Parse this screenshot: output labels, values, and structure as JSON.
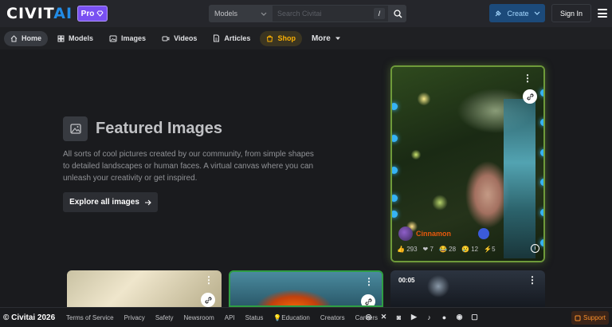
{
  "header": {
    "logo_main": "CIVIT",
    "logo_accent": "AI",
    "pro_label": "Pro",
    "search_scope": "Models",
    "search_placeholder": "Search Civitai",
    "search_shortcut": "/",
    "create_label": "Create",
    "signin_label": "Sign In"
  },
  "nav": {
    "items": [
      {
        "label": "Home",
        "icon": "home-icon"
      },
      {
        "label": "Models",
        "icon": "grid-icon"
      },
      {
        "label": "Images",
        "icon": "image-icon"
      },
      {
        "label": "Videos",
        "icon": "video-icon"
      },
      {
        "label": "Articles",
        "icon": "article-icon"
      },
      {
        "label": "Shop",
        "icon": "shop-icon"
      },
      {
        "label": "More",
        "icon": "chevron-down-icon"
      }
    ]
  },
  "hero": {
    "title": "Featured Images",
    "description": "All sorts of cool pictures created by our community, from simple shapes to detailed landscapes or human faces. A virtual canvas where you can unleash your creativity or get inspired.",
    "button_label": "Explore all images"
  },
  "featured_card": {
    "creator": "Cinnamon",
    "stats": [
      "293",
      "7",
      "28",
      "12",
      "5"
    ]
  },
  "bottom_cards": [
    {
      "duration": ""
    },
    {
      "duration": ""
    },
    {
      "duration": "00:05"
    }
  ],
  "footer": {
    "copyright": "© Civitai 2026",
    "links": [
      "Terms of Service",
      "Privacy",
      "Safety",
      "Newsroom",
      "API",
      "Status",
      "Education",
      "Creators",
      "Careers"
    ],
    "support_label": "Support"
  },
  "colors": {
    "background": "#1a1b1e",
    "header": "#25262b",
    "accent_blue": "#228be6",
    "pro_purple": "#7950f2",
    "shop_yellow": "#fab005"
  }
}
